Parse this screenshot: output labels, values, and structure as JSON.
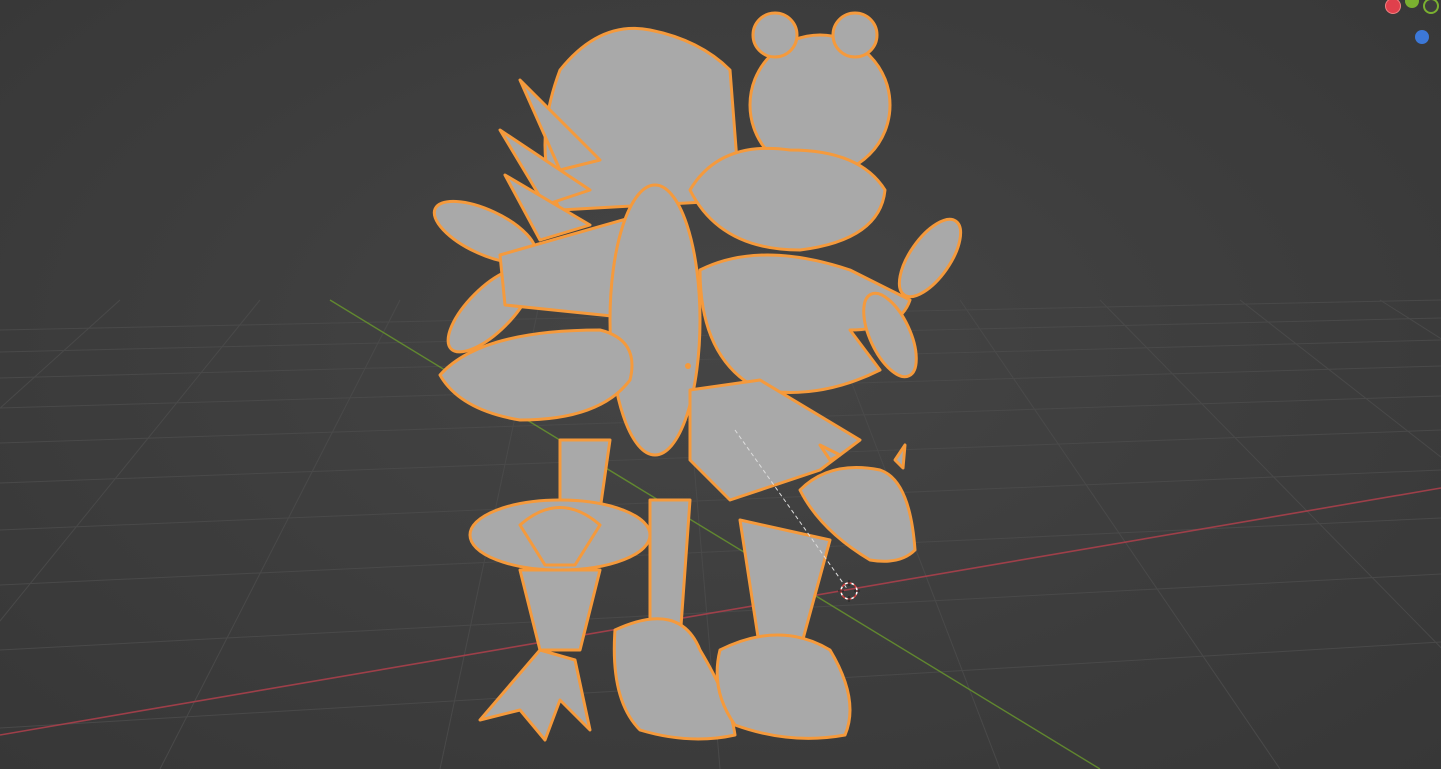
{
  "viewport": {
    "background_color": "#3d3d3d",
    "grid_color": "#4a4a4a",
    "x_axis_color": "#b0404c",
    "y_axis_color": "#6a9a2c",
    "outline_color": "#f59a3c",
    "mesh_color": "#a9a9a9"
  },
  "scene": {
    "object": "sculpted-creature-model",
    "selected": true
  },
  "gizmo": {
    "x_color": "#e0404c",
    "y_color": "#7ab030",
    "z_color": "#3c78d8"
  },
  "icons": {
    "cursor": "3d-cursor-icon"
  }
}
